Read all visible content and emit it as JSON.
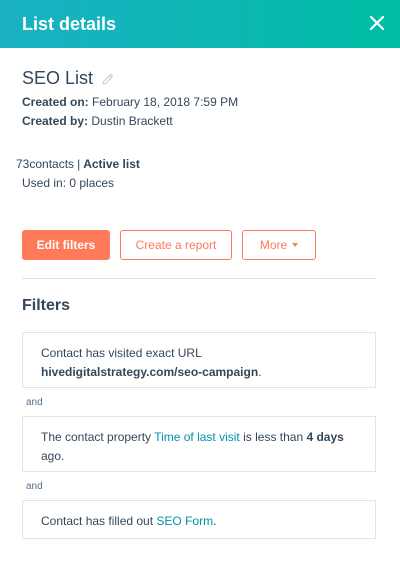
{
  "header": {
    "title": "List details",
    "close_icon": "close-icon"
  },
  "list": {
    "name": "SEO List",
    "edit_icon": "pencil-icon",
    "created_on_label": "Created on:",
    "created_on_value": "February 18, 2018 7:59 PM",
    "created_by_label": "Created by:",
    "created_by_value": "Dustin Brackett",
    "contacts_count": "73",
    "contacts_label": "contacts",
    "separator": "|",
    "list_type": "Active list",
    "used_in": "Used in: 0 places"
  },
  "actions": {
    "edit_filters": "Edit filters",
    "create_report": "Create a report",
    "more": "More"
  },
  "filters": {
    "heading": "Filters",
    "connector": "and",
    "items": [
      {
        "prefix": "Contact has visited exact URL ",
        "emphasis": "hivedigitalstrategy.com/seo-campaign",
        "suffix": "."
      },
      {
        "prefix": "The contact property ",
        "link": "Time of last visit",
        "middle": " is less than ",
        "emphasis": "4 days",
        "suffix": " ago."
      },
      {
        "prefix": "Contact has filled out ",
        "link": "SEO Form",
        "suffix": "."
      }
    ]
  },
  "colors": {
    "header_start": "#1bb1c4",
    "header_end": "#00bda5",
    "accent": "#ff7a59",
    "link": "#0091ae",
    "text": "#33475b"
  }
}
